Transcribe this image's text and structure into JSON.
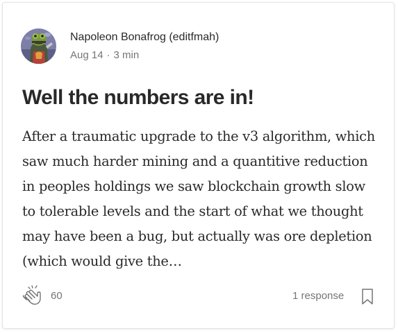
{
  "post": {
    "author": {
      "name": "Napoleon Bonafrog (editfmah)",
      "avatar_icon": "frog-avatar"
    },
    "date": "Aug 14",
    "separator": "·",
    "read_time": "3 min",
    "title": "Well the numbers are in!",
    "excerpt_lines": [
      "After a traumatic upgrade to the v3 algorithm, which",
      "saw much harder mining and a quantitive reduction",
      "in peoples holdings we saw blockchain growth slow",
      "to tolerable levels and the start of what we thought",
      "may have been a bug, but actually was ore depletion",
      "(which would give the…"
    ],
    "claps": "60",
    "responses": "1 response",
    "icons": {
      "clap": "clap-icon",
      "bookmark": "bookmark-icon"
    }
  },
  "colors": {
    "text_primary": "#292929",
    "text_secondary": "#757575",
    "card_border": "#e3e3e3"
  }
}
